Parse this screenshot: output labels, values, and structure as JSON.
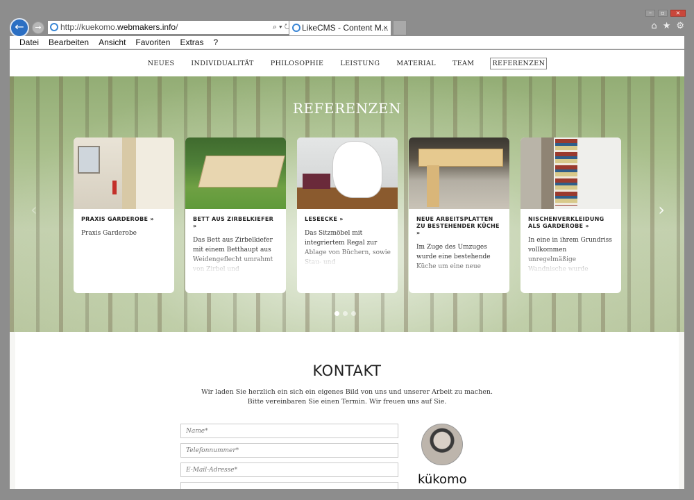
{
  "browser": {
    "url_prefix": "http://kuekomo.",
    "url_domain": "webmakers.info",
    "url_suffix": "/",
    "tab_title": "LikeCMS - Content M...",
    "tab_close": "×",
    "menu": [
      "Datei",
      "Bearbeiten",
      "Ansicht",
      "Favoriten",
      "Extras",
      "?"
    ]
  },
  "site_nav": {
    "items": [
      "NEUES",
      "INDIVIDUALITÄT",
      "PHILOSOPHIE",
      "LEISTUNG",
      "MATERIAL",
      "TEAM",
      "REFERENZEN"
    ],
    "active_index": 6
  },
  "hero": {
    "title": "REFERENZEN",
    "arrow_left": "‹",
    "arrow_right": "›",
    "active_dot": 0,
    "dot_count": 3
  },
  "cards": [
    {
      "title": "PRAXIS GARDEROBE »",
      "text": "Praxis Garderobe"
    },
    {
      "title": "BETT AUS ZIRBELKIEFER »",
      "text": "Das Bett aus Zirbelkiefer mit einem Betthaupt aus Weidengeflecht umrahmt von Zirbel und beidseitigen"
    },
    {
      "title": "LESEECKE »",
      "text": "Das Sitzmöbel mit integriertem Regal zur Ablage von Büchern, sowie Stau- und Aufbewahrungsraum."
    },
    {
      "title": "NEUE ARBEITSPLATTEN ZU BESTEHENDER KÜCHE »",
      "text": "Im Zuge des Umzuges wurde eine bestehende Küche um eine neue"
    },
    {
      "title": "NISCHENVERKLEIDUNG ALS GARDEROBE »",
      "text": "In eine in ihrem Grundriss vollkommen unregelmäßige Wandnische wurde"
    }
  ],
  "kontakt": {
    "title": "KONTAKT",
    "intro_line1": "Wir laden Sie herzlich ein sich ein eigenes Bild von uns und unserer Arbeit zu machen.",
    "intro_line2": "Bitte vereinbaren Sie einen Termin. Wir freuen uns auf Sie.",
    "name_placeholder": "Name*",
    "phone_placeholder": "Telefonnummer*",
    "email_placeholder": "E-Mail-Adresse*",
    "brand": "kükomo"
  }
}
